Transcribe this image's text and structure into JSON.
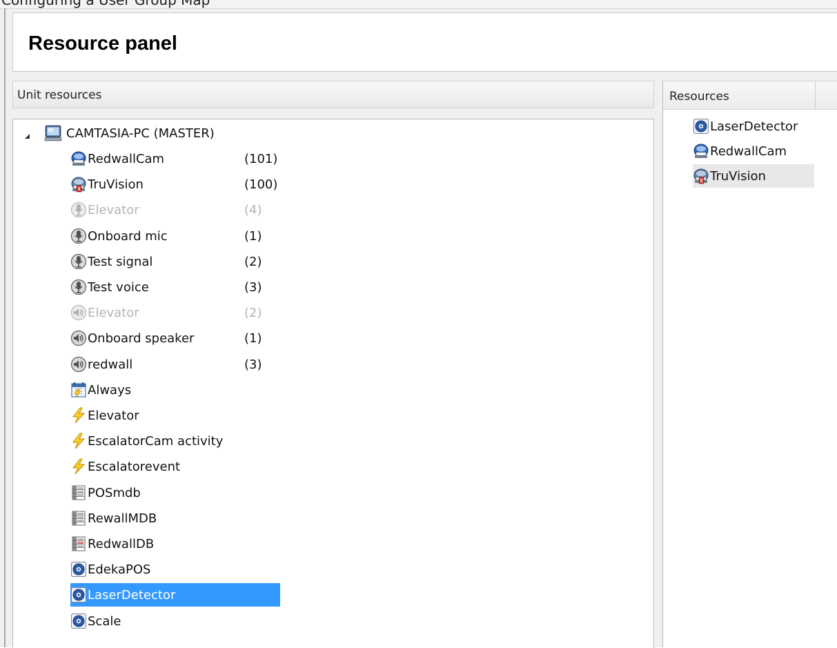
{
  "title": "Resource panel",
  "unit_resources": {
    "header": "Unit resources",
    "root": {
      "label": "CAMTASIA-PC (MASTER)",
      "icon": "computer-icon",
      "expanded": true
    },
    "items": [
      {
        "label": "RedwallCam",
        "count": "(101)",
        "icon": "camera-icon",
        "disabled": false
      },
      {
        "label": "TruVision",
        "count": "(100)",
        "icon": "camera-icon",
        "disabled": false
      },
      {
        "label": "Elevator",
        "count": "(4)",
        "icon": "microphone-icon",
        "disabled": true
      },
      {
        "label": "Onboard mic",
        "count": "(1)",
        "icon": "microphone-icon",
        "disabled": false
      },
      {
        "label": "Test signal",
        "count": "(2)",
        "icon": "microphone-icon",
        "disabled": false
      },
      {
        "label": "Test voice",
        "count": "(3)",
        "icon": "microphone-icon",
        "disabled": false
      },
      {
        "label": "Elevator",
        "count": "(2)",
        "icon": "speaker-icon",
        "disabled": true
      },
      {
        "label": "Onboard speaker",
        "count": "(1)",
        "icon": "speaker-icon",
        "disabled": false
      },
      {
        "label": "redwall",
        "count": "(3)",
        "icon": "speaker-icon",
        "disabled": false
      },
      {
        "label": "Always",
        "icon": "calendar-icon",
        "disabled": false
      },
      {
        "label": "Elevator",
        "icon": "lightning-icon",
        "disabled": false
      },
      {
        "label": "EscalatorCam activity",
        "icon": "lightning-icon",
        "disabled": false
      },
      {
        "label": "Escalatorevent",
        "icon": "lightning-icon",
        "disabled": false
      },
      {
        "label": "POSmdb",
        "icon": "database-icon",
        "disabled": false
      },
      {
        "label": "RewallMDB",
        "icon": "database-icon",
        "disabled": false
      },
      {
        "label": "RedwallDB",
        "icon": "database-icon",
        "disabled": false
      },
      {
        "label": "EdekaPOS",
        "icon": "gear-device-icon",
        "disabled": false
      },
      {
        "label": "LaserDetector",
        "icon": "gear-device-icon",
        "disabled": false,
        "selected": true
      },
      {
        "label": "Scale",
        "icon": "gear-device-icon",
        "disabled": false
      }
    ]
  },
  "resources": {
    "header": "Resources",
    "items": [
      {
        "label": "LaserDetector",
        "icon": "gear-device-icon"
      },
      {
        "label": "RedwallCam",
        "icon": "camera-icon"
      },
      {
        "label": "TruVision",
        "icon": "camera-icon",
        "selected": true
      }
    ]
  },
  "colors": {
    "selection": "#3399ff",
    "selection_inactive": "#e8e8ea",
    "disabled_text": "#b4b4b4"
  }
}
